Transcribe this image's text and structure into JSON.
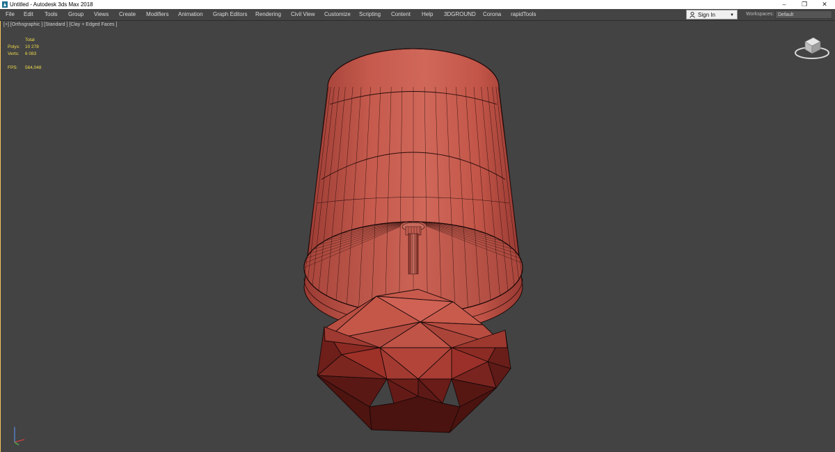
{
  "window": {
    "title": "Untitled - Autodesk 3ds Max 2018",
    "buttons": {
      "minimize": "–",
      "maximize": "❐",
      "close": "✕"
    }
  },
  "menu": {
    "items": [
      "File",
      "Edit",
      "Tools",
      "Group",
      "Views",
      "Create",
      "Modifiers",
      "Animation",
      "Graph Editors",
      "Rendering",
      "Civil View",
      "Customize",
      "Scripting",
      "Content",
      "Help",
      "3DGROUND",
      "Corona",
      "rapidTools"
    ],
    "sign_in": "Sign In",
    "workspaces_label": "Workspaces:",
    "workspaces_value": "Default"
  },
  "viewport": {
    "label": "[+] [Orthographic ] [Standard ] [Clay + Edged Faces ]",
    "stats": {
      "header": "Total",
      "polys_label": "Polys:",
      "polys_value": "10 278",
      "verts_label": "Verts:",
      "verts_value": "6 083",
      "fps_label": "FPS:",
      "fps_value": "564,048"
    }
  },
  "colors": {
    "viewport_bg": "#434343",
    "clay": "#c95a4c",
    "stats_text": "#f0dc4a",
    "wire": "#1a0808"
  },
  "icons": [
    "app-icon",
    "person-icon",
    "dropdown-caret-icon",
    "viewcube-icon",
    "axis-tripod-icon"
  ]
}
